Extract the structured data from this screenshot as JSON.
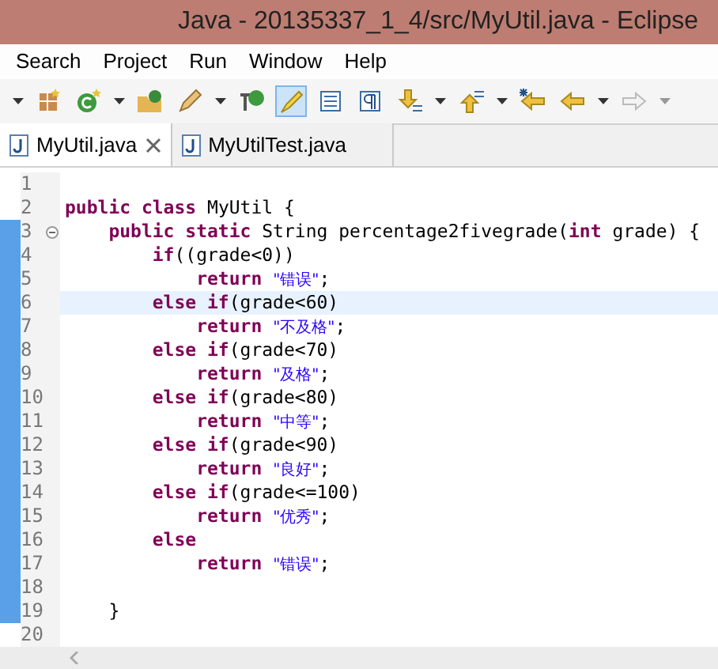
{
  "window": {
    "title": "Java - 20135337_1_4/src/MyUtil.java - Eclipse"
  },
  "menu": [
    "Search",
    "Project",
    "Run",
    "Window",
    "Help"
  ],
  "tabs": [
    {
      "label": "MyUtil.java",
      "selected": true
    },
    {
      "label": "MyUtilTest.java",
      "selected": false
    }
  ],
  "editor": {
    "lines": [
      {
        "number": "1",
        "current": false,
        "changed": false,
        "foldable": false
      },
      {
        "number": "2",
        "current": false,
        "changed": false,
        "foldable": false,
        "segments": [
          {
            "kind": "keyword",
            "text": "public class"
          },
          {
            "kind": "plain",
            "text": " MyUtil {"
          }
        ]
      },
      {
        "number": "3",
        "current": false,
        "changed": true,
        "foldable": true,
        "segments": [
          {
            "kind": "keyword",
            "text": "    public static"
          },
          {
            "kind": "plain",
            "text": " String percentage2fivegrade("
          },
          {
            "kind": "keyword",
            "text": "int"
          },
          {
            "kind": "plain",
            "text": " grade) {"
          }
        ]
      },
      {
        "number": "4",
        "current": false,
        "changed": true,
        "foldable": false,
        "segments": [
          {
            "kind": "keyword",
            "text": "        if"
          },
          {
            "kind": "plain",
            "text": "((grade<0))"
          }
        ]
      },
      {
        "number": "5",
        "current": false,
        "changed": true,
        "foldable": false,
        "segments": [
          {
            "kind": "keyword",
            "text": "            return "
          },
          {
            "kind": "string",
            "text": "\"错误\""
          },
          {
            "kind": "plain",
            "text": ";"
          }
        ]
      },
      {
        "number": "6",
        "current": true,
        "changed": true,
        "foldable": false,
        "segments": [
          {
            "kind": "keyword",
            "text": "        else if"
          },
          {
            "kind": "plain",
            "text": "(grade<60)"
          }
        ]
      },
      {
        "number": "7",
        "current": false,
        "changed": true,
        "foldable": false,
        "segments": [
          {
            "kind": "keyword",
            "text": "            return "
          },
          {
            "kind": "string",
            "text": "\"不及格\""
          },
          {
            "kind": "plain",
            "text": ";"
          }
        ]
      },
      {
        "number": "8",
        "current": false,
        "changed": true,
        "foldable": false,
        "segments": [
          {
            "kind": "keyword",
            "text": "        else if"
          },
          {
            "kind": "plain",
            "text": "(grade<70)"
          }
        ]
      },
      {
        "number": "9",
        "current": false,
        "changed": true,
        "foldable": false,
        "segments": [
          {
            "kind": "keyword",
            "text": "            return "
          },
          {
            "kind": "string",
            "text": "\"及格\""
          },
          {
            "kind": "plain",
            "text": ";"
          }
        ]
      },
      {
        "number": "10",
        "current": false,
        "changed": true,
        "foldable": false,
        "segments": [
          {
            "kind": "keyword",
            "text": "        else if"
          },
          {
            "kind": "plain",
            "text": "(grade<80)"
          }
        ]
      },
      {
        "number": "11",
        "current": false,
        "changed": true,
        "foldable": false,
        "segments": [
          {
            "kind": "keyword",
            "text": "            return "
          },
          {
            "kind": "string",
            "text": "\"中等\""
          },
          {
            "kind": "plain",
            "text": ";"
          }
        ]
      },
      {
        "number": "12",
        "current": false,
        "changed": true,
        "foldable": false,
        "segments": [
          {
            "kind": "keyword",
            "text": "        else if"
          },
          {
            "kind": "plain",
            "text": "(grade<90)"
          }
        ]
      },
      {
        "number": "13",
        "current": false,
        "changed": true,
        "foldable": false,
        "segments": [
          {
            "kind": "keyword",
            "text": "            return "
          },
          {
            "kind": "string",
            "text": "\"良好\""
          },
          {
            "kind": "plain",
            "text": ";"
          }
        ]
      },
      {
        "number": "14",
        "current": false,
        "changed": true,
        "foldable": false,
        "segments": [
          {
            "kind": "keyword",
            "text": "        else if"
          },
          {
            "kind": "plain",
            "text": "(grade<=100)"
          }
        ]
      },
      {
        "number": "15",
        "current": false,
        "changed": true,
        "foldable": false,
        "segments": [
          {
            "kind": "keyword",
            "text": "            return "
          },
          {
            "kind": "string",
            "text": "\"优秀\""
          },
          {
            "kind": "plain",
            "text": ";"
          }
        ]
      },
      {
        "number": "16",
        "current": false,
        "changed": true,
        "foldable": false,
        "segments": [
          {
            "kind": "keyword",
            "text": "        else"
          }
        ]
      },
      {
        "number": "17",
        "current": false,
        "changed": true,
        "foldable": false,
        "segments": [
          {
            "kind": "keyword",
            "text": "            return "
          },
          {
            "kind": "string",
            "text": "\"错误\""
          },
          {
            "kind": "plain",
            "text": ";"
          }
        ]
      },
      {
        "number": "18",
        "current": false,
        "changed": true,
        "foldable": false
      },
      {
        "number": "19",
        "current": false,
        "changed": true,
        "foldable": false,
        "segments": [
          {
            "kind": "plain",
            "text": "    }"
          }
        ]
      },
      {
        "number": "20",
        "current": false,
        "changed": false,
        "foldable": false
      }
    ]
  }
}
